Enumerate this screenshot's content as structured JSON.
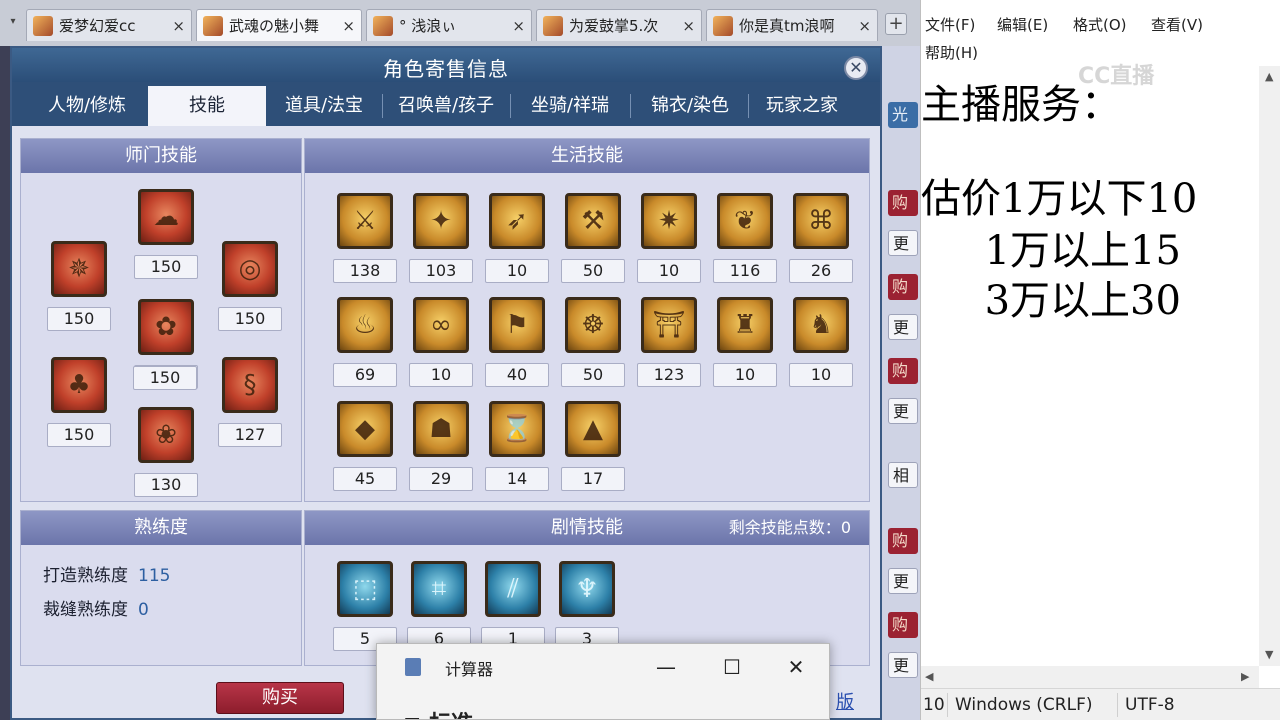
{
  "browser": {
    "tabs": [
      {
        "label": "爱梦幻爱cc"
      },
      {
        "label": "武魂の魅小舞"
      },
      {
        "label": "° 浅浪ぃ"
      },
      {
        "label": "为爱鼓掌5.次"
      },
      {
        "label": "你是真tm浪啊"
      }
    ],
    "close_glyph": "×",
    "add_glyph": "+",
    "menu_glyph": "▾"
  },
  "side_strip": {
    "buttons": [
      "光",
      "购",
      "更",
      "购",
      "更",
      "购",
      "更",
      "相",
      "购",
      "更",
      "购",
      "更"
    ]
  },
  "dialog": {
    "title": "角色寄售信息",
    "close_glyph": "✕",
    "tabs": [
      "人物/修炼",
      "技能",
      "道具/法宝",
      "召唤兽/孩子",
      "坐骑/祥瑞",
      "锦衣/染色",
      "玩家之家"
    ],
    "active_tab": "技能",
    "sect_skills": {
      "title": "师门技能",
      "levels": [
        "150",
        "150",
        "150",
        "150",
        "150",
        "150",
        "127",
        "130"
      ]
    },
    "life_skills": {
      "title": "生活技能",
      "levels": [
        "138",
        "103",
        "10",
        "50",
        "10",
        "116",
        "26",
        "69",
        "10",
        "40",
        "50",
        "123",
        "10",
        "10",
        "45",
        "29",
        "14",
        "17"
      ]
    },
    "proficiency": {
      "title": "熟练度",
      "rows": [
        {
          "label": "打造熟练度",
          "value": "115"
        },
        {
          "label": "裁缝熟练度",
          "value": "0"
        }
      ]
    },
    "story_skills": {
      "title": "剧情技能",
      "remaining_label": "剩余技能点数：",
      "remaining_value": "0",
      "levels": [
        "5",
        "6",
        "1",
        "3"
      ]
    },
    "buy_label": "购买",
    "version_link": "版"
  },
  "calculator": {
    "title": "计算器",
    "mode": "≡  标准",
    "minimize": "—",
    "maximize": "☐",
    "close": "✕"
  },
  "notepad": {
    "menu": [
      "文件(F)",
      "编辑(E)",
      "格式(O)",
      "查看(V)",
      "帮助(H)"
    ],
    "lines": [
      "主播服务：",
      "",
      "估价1万以下10",
      "     1万以上15",
      "     3万以上30"
    ],
    "status": {
      "position": "10",
      "line_ending": "Windows (CRLF)",
      "encoding": "UTF-8"
    }
  },
  "watermark": "CC直播",
  "colors": {
    "dialog_header": "#2e4f78",
    "panel_header": "#7b84b8",
    "buy_button": "#a02a3a",
    "sect_icon": "#c0402a",
    "life_icon": "#d4a03a",
    "story_icon": "#2d80a8"
  }
}
